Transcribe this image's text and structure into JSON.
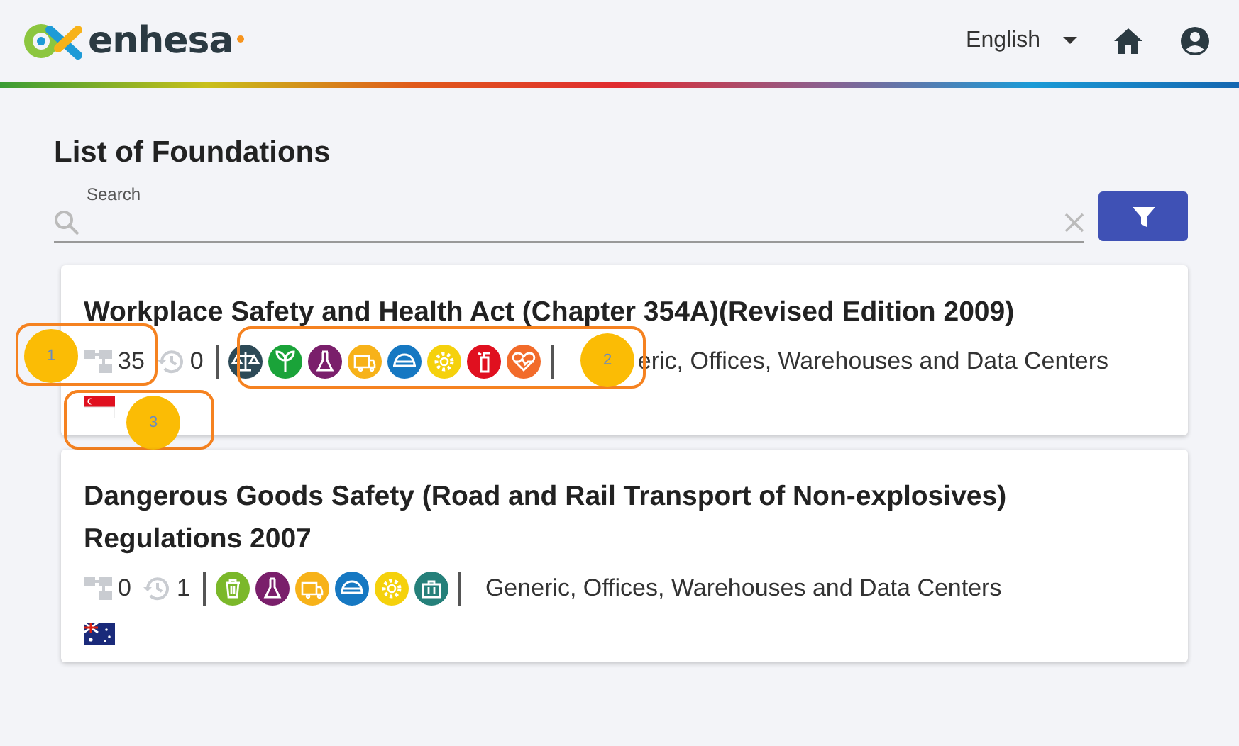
{
  "header": {
    "brand": "enhesa",
    "language": "English"
  },
  "page": {
    "title": "List of Foundations"
  },
  "search": {
    "label": "Search"
  },
  "foundations": [
    {
      "title": "Workplace Safety and Health Act (Chapter 354A)(Revised Edition 2009)",
      "requirements": "35",
      "revisions": "0",
      "topics": [
        {
          "kind": "scales",
          "color": "#2d4a57"
        },
        {
          "kind": "leaf",
          "color": "#1aa339"
        },
        {
          "kind": "flask",
          "color": "#7a1f6b"
        },
        {
          "kind": "truck",
          "color": "#f7b219"
        },
        {
          "kind": "helmet",
          "color": "#1678c2"
        },
        {
          "kind": "gear",
          "color": "#f5d10c"
        },
        {
          "kind": "extinguisher",
          "color": "#e0101f"
        },
        {
          "kind": "heart",
          "color": "#f26b2a"
        }
      ],
      "scope": "eric, Offices, Warehouses and Data Centers",
      "flag": {
        "kind": "singapore"
      },
      "callouts": [
        "1",
        "2",
        "3"
      ]
    },
    {
      "title": "Dangerous Goods Safety (Road and Rail Transport of Non-explosives) Regulations 2007",
      "requirements": "0",
      "revisions": "1",
      "topics": [
        {
          "kind": "bin",
          "color": "#7bb82a"
        },
        {
          "kind": "flask",
          "color": "#7a1f6b"
        },
        {
          "kind": "truck",
          "color": "#f7b219"
        },
        {
          "kind": "helmet",
          "color": "#1678c2"
        },
        {
          "kind": "gear",
          "color": "#f5d10c"
        },
        {
          "kind": "case",
          "color": "#25807a"
        }
      ],
      "scope": "Generic, Offices, Warehouses and Data Centers",
      "flag": {
        "kind": "australia"
      }
    }
  ]
}
